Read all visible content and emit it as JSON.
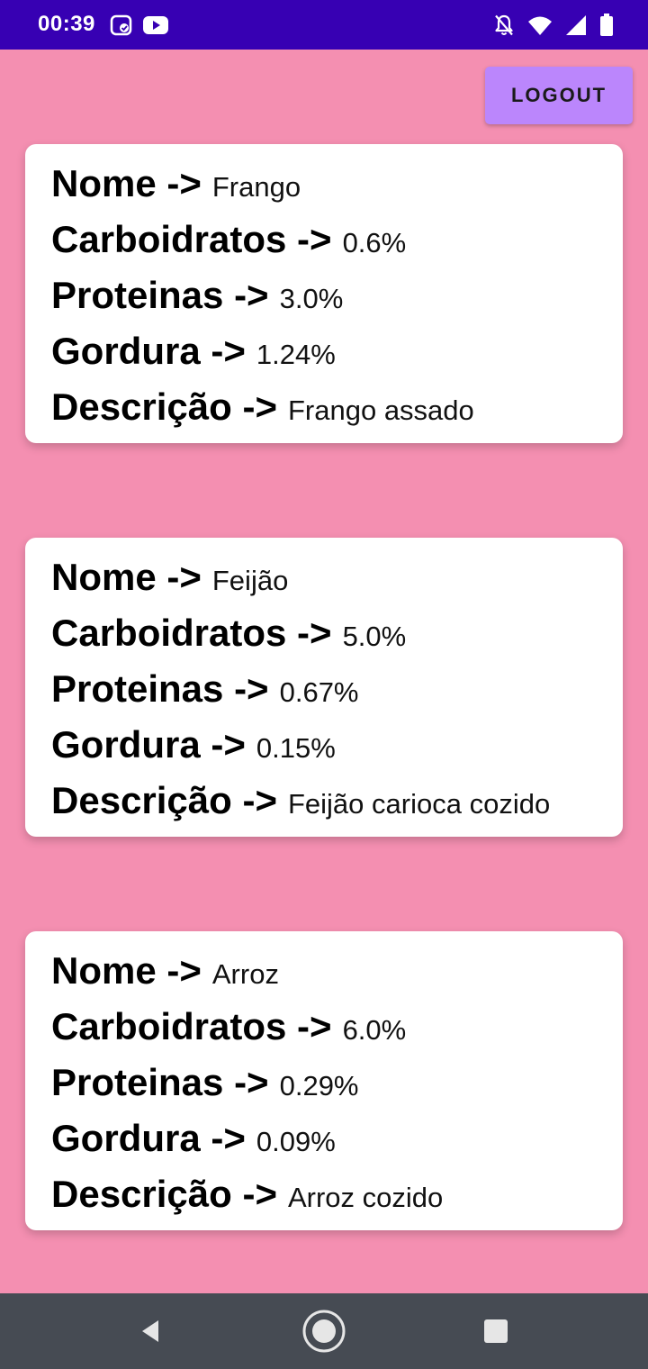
{
  "status_bar": {
    "time": "00:39",
    "icons": [
      "cast-icon",
      "youtube-icon",
      "notifications-off-icon",
      "wifi-icon",
      "signal-icon",
      "battery-icon"
    ]
  },
  "header": {
    "logout_label": "LOGOUT"
  },
  "labels": {
    "nome": "Nome ->",
    "carboidratos": "Carboidratos ->",
    "proteinas": "Proteinas ->",
    "gordura": "Gordura ->",
    "descricao": "Descrição ->"
  },
  "foods": [
    {
      "nome": "Frango",
      "carboidratos": "0.6%",
      "proteinas": "3.0%",
      "gordura": "1.24%",
      "descricao": "Frango assado"
    },
    {
      "nome": "Feijão",
      "carboidratos": "5.0%",
      "proteinas": "0.67%",
      "gordura": "0.15%",
      "descricao": "Feijão carioca cozido"
    },
    {
      "nome": "Arroz",
      "carboidratos": "6.0%",
      "proteinas": "0.29%",
      "gordura": "0.09%",
      "descricao": "Arroz cozido"
    }
  ],
  "colors": {
    "status_bar": "#3700b3",
    "background": "#f48fb1",
    "logout_button": "#bb86fc",
    "card": "#ffffff",
    "nav_bar": "#464b53"
  },
  "nav_bar": {
    "icons": [
      "back-icon",
      "home-icon",
      "recents-icon"
    ]
  }
}
